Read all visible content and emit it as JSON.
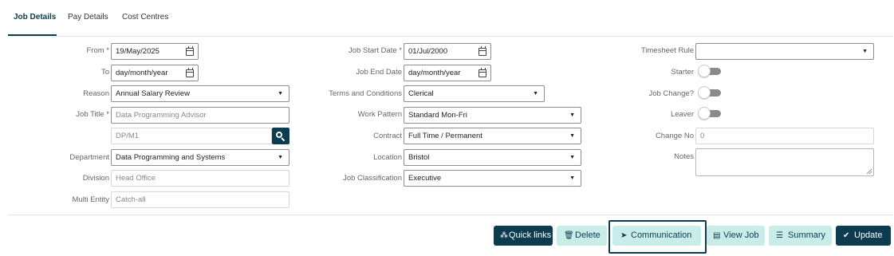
{
  "tabs": [
    {
      "label": "Job Details",
      "active": true
    },
    {
      "label": "Pay Details",
      "active": false
    },
    {
      "label": "Cost Centres",
      "active": false
    }
  ],
  "left": {
    "from": {
      "label": "From *",
      "value": "19/May/2025"
    },
    "to": {
      "label": "To",
      "value": "day/month/year"
    },
    "reason": {
      "label": "Reason",
      "value": "Annual Salary Review"
    },
    "job_title": {
      "label": "Job Title *",
      "placeholder": "Data Programming Advisor"
    },
    "job_code": {
      "placeholder": "DP/M1"
    },
    "department": {
      "label": "Department",
      "value": "Data Programming and Systems"
    },
    "division": {
      "label": "Division",
      "value": "Head Office"
    },
    "multi_entity": {
      "label": "Multi Entity",
      "value": "Catch-all"
    }
  },
  "middle": {
    "job_start_date": {
      "label": "Job Start Date *",
      "value": "01/Jul/2000"
    },
    "job_end_date": {
      "label": "Job End Date",
      "value": "day/month/year"
    },
    "terms": {
      "label": "Terms and Conditions",
      "value": "Clerical"
    },
    "work_pattern": {
      "label": "Work Pattern",
      "value": "Standard Mon-Fri"
    },
    "contract": {
      "label": "Contract",
      "value": "Full Time / Permanent"
    },
    "location": {
      "label": "Location",
      "value": "Bristol"
    },
    "job_classification": {
      "label": "Job Classification",
      "value": "Executive"
    }
  },
  "right": {
    "timesheet_rule": {
      "label": "Timesheet Rule",
      "value": ""
    },
    "starter": {
      "label": "Starter",
      "on": false
    },
    "job_change": {
      "label": "Job Change?",
      "on": false
    },
    "leaver": {
      "label": "Leaver",
      "on": false
    },
    "change_no": {
      "label": "Change No",
      "value": "0"
    },
    "notes": {
      "label": "Notes",
      "value": ""
    }
  },
  "buttons": {
    "quick_links": "Quick links",
    "delete": "Delete",
    "communication": "Communication",
    "view_job": "View Job",
    "summary": "Summary",
    "update": "Update"
  },
  "icons": {
    "calendar": "calendar-icon",
    "caret": "▼",
    "quick_links": "⁂",
    "delete": "🗑",
    "communication": "➤",
    "view_job": "▤",
    "summary": "☰",
    "update": "✔"
  },
  "colors": {
    "primary": "#0d3b4f",
    "secondary": "#c9ece8"
  }
}
